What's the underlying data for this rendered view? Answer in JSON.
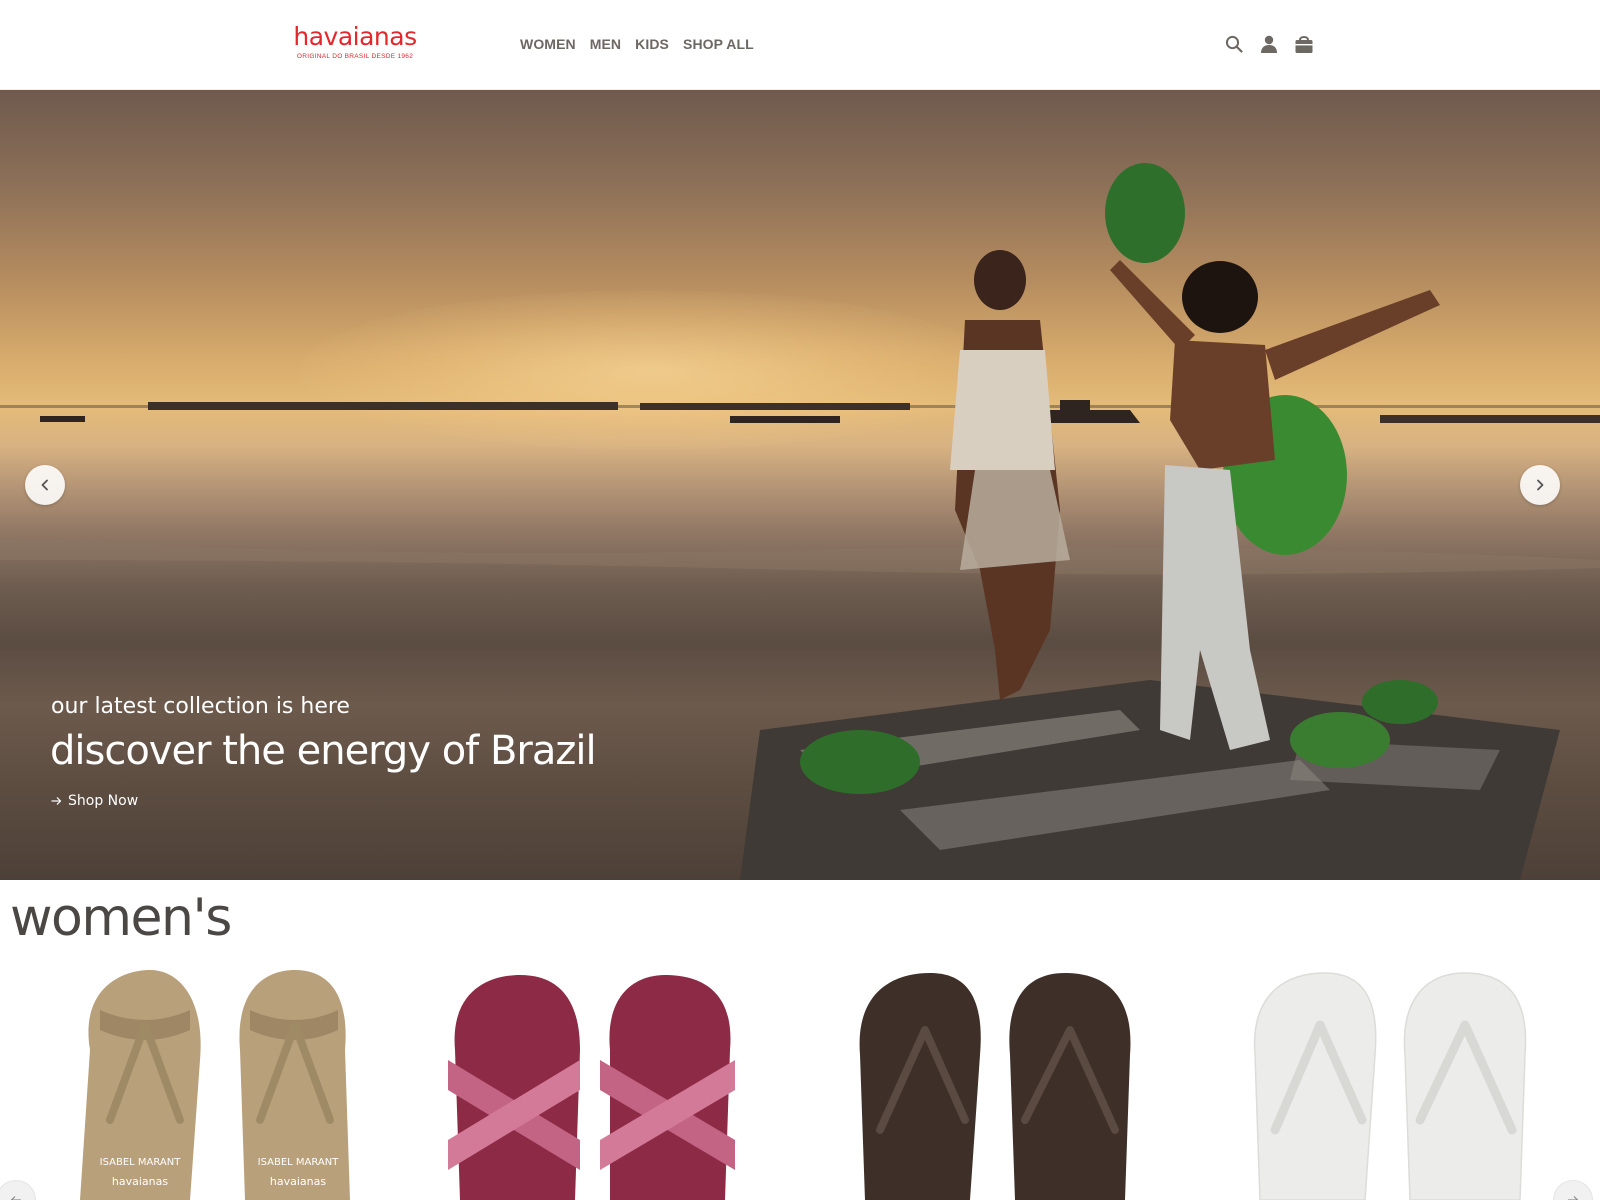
{
  "brand": {
    "name": "havaianas",
    "tagline": "ORIGINAL DO BRASIL DESDE 1962",
    "color": "#e4262d"
  },
  "nav": {
    "items": [
      {
        "label": "WOMEN"
      },
      {
        "label": "MEN"
      },
      {
        "label": "KIDS"
      },
      {
        "label": "SHOP ALL"
      }
    ]
  },
  "header_icons": [
    "search-icon",
    "account-icon",
    "cart-icon"
  ],
  "hero": {
    "subtitle": "our latest collection is here",
    "title": "discover the energy of Brazil",
    "cta_label": "Shop Now",
    "prev_icon": "chevron-left-icon",
    "next_icon": "chevron-right-icon"
  },
  "womens": {
    "title": "women's",
    "products": [
      {
        "name": "isabel-marant-flip-flops",
        "color": "#b49a72",
        "print": "ISABEL MARANT x havaianas"
      },
      {
        "name": "pink-cross-strap-sandals",
        "color": "#b54a68"
      },
      {
        "name": "dark-brown-flip-flops",
        "color": "#4a3a33"
      },
      {
        "name": "white-flip-flops",
        "color": "#ececea"
      }
    ]
  }
}
